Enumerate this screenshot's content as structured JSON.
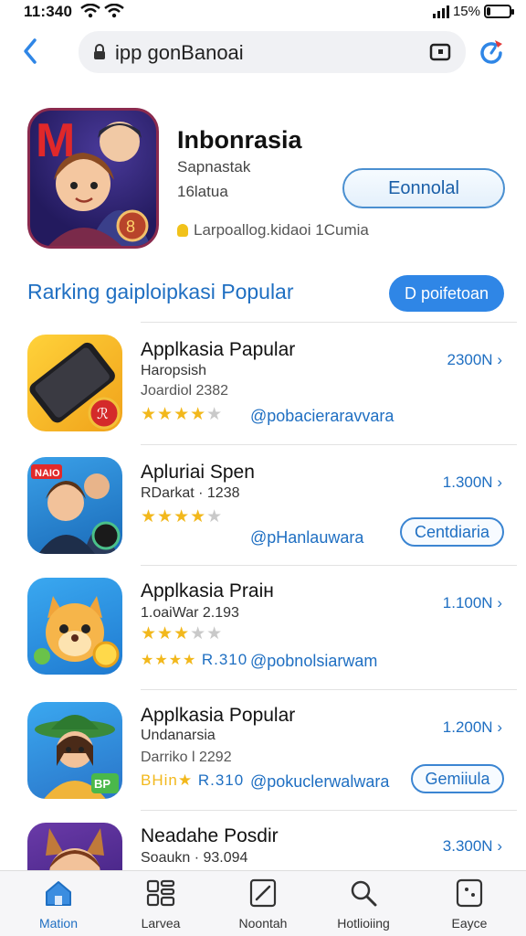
{
  "status": {
    "time": "11:340",
    "battery": "15%",
    "battery_level": 0.15
  },
  "nav": {
    "url": "ipp gonBanoai"
  },
  "hero": {
    "title": "Inbonrasia",
    "sub1": "Sapnastak",
    "sub2": "16latua",
    "button": "Eonnolal",
    "info": "Larpoallog.kidaoi 1Cumia"
  },
  "section": {
    "title": "Rarking gaiploipkasi Popular",
    "button": "D poifetoan"
  },
  "apps": [
    {
      "name": "Applkasia Papular",
      "line1": "Haropsish",
      "line2": "Joardiol 2382",
      "stars": 4,
      "dev": "@pobacieraravvara",
      "size": "2300N",
      "action": ""
    },
    {
      "name": "Apluriai Spen",
      "line1": "RDarkat · 1238",
      "line2": "",
      "stars": 4,
      "dev": "@pHanlauwara",
      "size": "1.300N",
      "action": "Centdiaria"
    },
    {
      "name": "Applkasia Praiн",
      "line1": "1.oaiWar 2.193",
      "line2": "",
      "stars": 3,
      "dev": "@pobnolsiarwam",
      "size": "1.100N",
      "action": "",
      "rating_text": "R.310"
    },
    {
      "name": "Applkasia Popular",
      "line1": "Undanarsia",
      "line2": "Darriko l 2292",
      "stars": 0,
      "dev": "@pokuclerwalwara",
      "size": "1.200N",
      "action": "Gemiiula",
      "rating_text": "R.310",
      "badge": "BHin★"
    },
    {
      "name": "Neadahe Posdir",
      "line1": "Soaukn · 93.094",
      "line2": "",
      "stars": 0,
      "dev": "",
      "size": "3.300N",
      "action": ""
    }
  ],
  "bottom_nav": [
    "Mation",
    "Larvea",
    "Noontah",
    "Hotlioiing",
    "Eayce"
  ]
}
